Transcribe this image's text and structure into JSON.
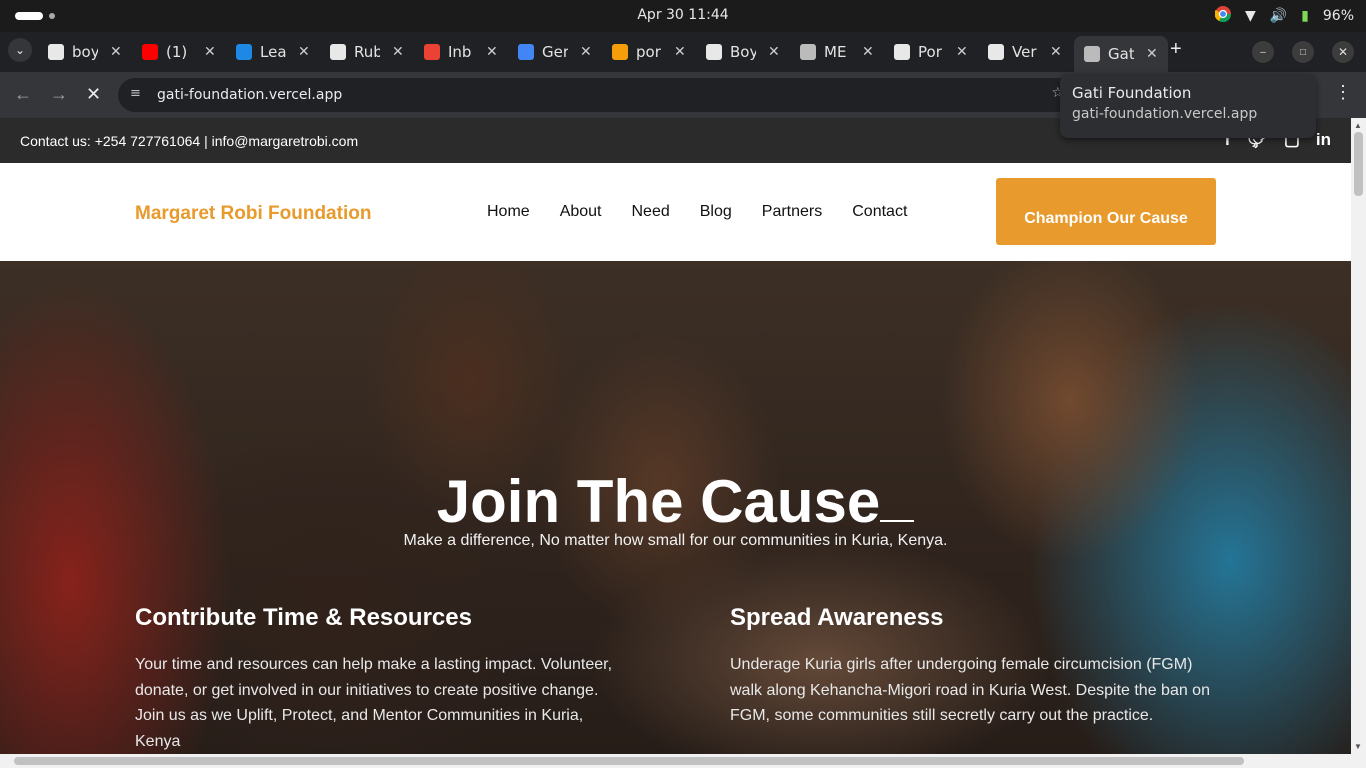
{
  "system": {
    "clock": "Apr 30  11:44",
    "battery": "96%"
  },
  "tabs": [
    {
      "title": "boy",
      "icon": "github-icon",
      "color": "#ffffff"
    },
    {
      "title": "(1)",
      "icon": "youtube-icon",
      "color": "#ff0000"
    },
    {
      "title": "Lea",
      "icon": "bracket-icon",
      "color": "#1e88e5"
    },
    {
      "title": "Rub",
      "icon": "w3-icon",
      "color": "#ffffff"
    },
    {
      "title": "Inb",
      "icon": "gmail-icon",
      "color": "#ea4335"
    },
    {
      "title": "Ger",
      "icon": "gemini-icon",
      "color": "#4285f4"
    },
    {
      "title": "por",
      "icon": "g-icon",
      "color": "#f59e0b"
    },
    {
      "title": "Boy",
      "icon": "person-icon",
      "color": "#ffffff"
    },
    {
      "title": "ME",
      "icon": "globe-icon",
      "color": "#bbbbbb"
    },
    {
      "title": "Por",
      "icon": "openai-icon",
      "color": "#ffffff"
    },
    {
      "title": "Ver",
      "icon": "vercel-icon",
      "color": "#ffffff"
    },
    {
      "title": "Gat",
      "icon": "globe-icon",
      "color": "#bbbbbb"
    }
  ],
  "browser": {
    "url": "gati-foundation.vercel.app",
    "tooltip_title": "Gati Foundation",
    "tooltip_url": "gati-foundation.vercel.app"
  },
  "site": {
    "contact": "Contact us: +254 727761064 | info@margaretrobi.com",
    "brand": "Margaret Robi Foundation",
    "nav": [
      "Home",
      "About",
      "Need",
      "Blog",
      "Partners",
      "Contact"
    ],
    "cta": "Champion Our Cause",
    "accent": "#e89a2c",
    "hero": {
      "title": "Join The Cause",
      "subtitle": "Make a difference, No matter how small for our communities in Kuria, Kenya."
    },
    "columns": [
      {
        "heading": "Contribute Time & Resources",
        "body": "Your time and resources can help make a lasting impact. Volunteer, donate, or get involved in our initiatives to create positive change. Join us as we Uplift, Protect, and Mentor Communities in Kuria, Kenya"
      },
      {
        "heading": "Spread Awareness",
        "body": "Underage Kuria girls after undergoing female circumcision (FGM) walk along Kehancha-Migori road in Kuria West. Despite the ban on FGM, some communities still secretly carry out the practice."
      }
    ]
  }
}
